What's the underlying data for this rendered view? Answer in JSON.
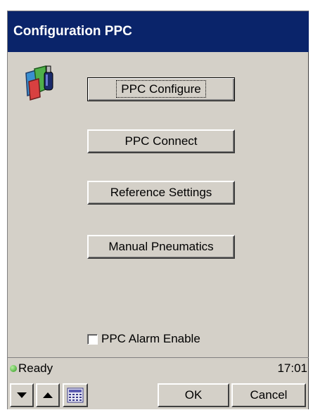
{
  "window": {
    "title": "Configuration PPC"
  },
  "main": {
    "buttons": [
      {
        "label": "PPC Configure"
      },
      {
        "label": "PPC Connect"
      },
      {
        "label": "Reference Settings"
      },
      {
        "label": "Manual Pneumatics"
      }
    ],
    "alarm_checkbox": {
      "label": "PPC Alarm Enable",
      "checked": false
    }
  },
  "statusbar": {
    "status": "Ready",
    "status_color": "#2f9a1e",
    "time": "17:01"
  },
  "toolbar": {
    "down_icon": "arrow-down-icon",
    "up_icon": "arrow-up-icon",
    "keypad_icon": "keypad-icon",
    "ok_label": "OK",
    "cancel_label": "Cancel"
  },
  "colors": {
    "titlebar": "#0a246a",
    "face": "#d4d0c8"
  }
}
